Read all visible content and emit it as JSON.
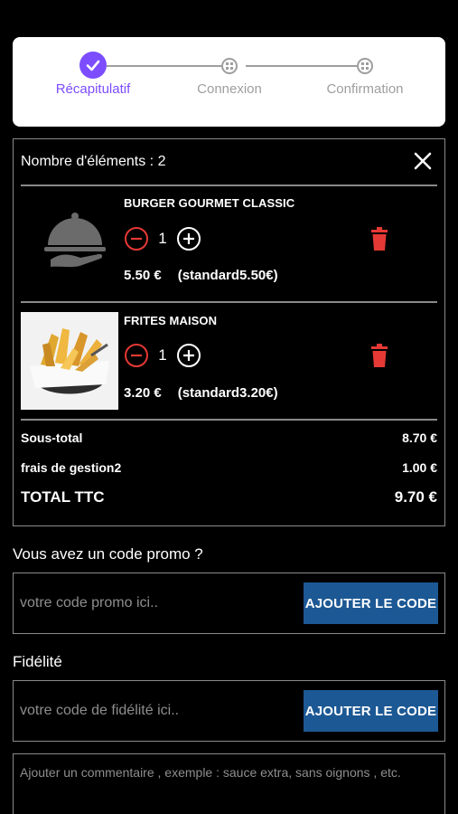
{
  "stepper": {
    "steps": [
      {
        "label": "Récapitulatif",
        "state": "completed"
      },
      {
        "label": "Connexion",
        "state": "pending"
      },
      {
        "label": "Confirmation",
        "state": "pending"
      }
    ],
    "active_color": "#7c4dff",
    "inactive_color": "#9e9e9e"
  },
  "cart": {
    "count_label": "Nombre d'éléments : 2",
    "items": [
      {
        "name": "BURGER GOURMET CLASSIC",
        "quantity": "1",
        "price": "5.50 €",
        "standard": "(standard5.50€)",
        "image_icon": "serving-cloche-icon"
      },
      {
        "name": "FRITES MAISON",
        "quantity": "1",
        "price": "3.20 €",
        "standard": "(standard3.20€)",
        "image_icon": "fries-basket-image"
      }
    ],
    "subtotal_label": "Sous-total",
    "subtotal_value": "8.70 €",
    "fees_label": "frais de gestion2",
    "fees_value": "1.00 €",
    "total_label": "TOTAL TTC",
    "total_value": "9.70 €",
    "accent_red": "#e53935"
  },
  "promo": {
    "title": "Vous avez un code promo ?",
    "placeholder": "votre code promo ici..",
    "button": "AJOUTER LE CODE"
  },
  "fidelity": {
    "title": "Fidélité",
    "placeholder": "votre code de fidélité ici..",
    "button": "AJOUTER LE CODE"
  },
  "comment": {
    "placeholder": "Ajouter un commentaire , exemple : sauce extra, sans oignons , etc."
  },
  "button_color": "#1c5894"
}
